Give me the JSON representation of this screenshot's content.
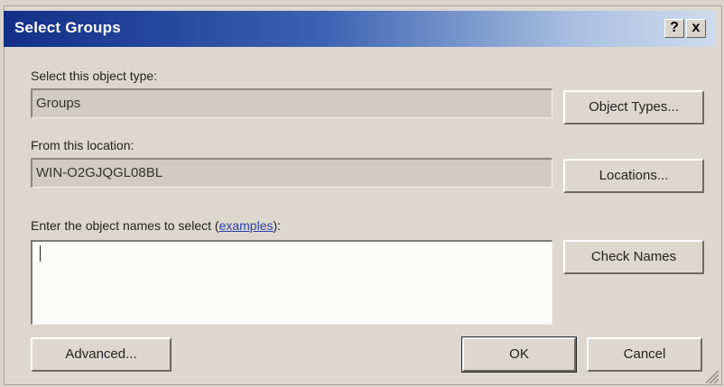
{
  "dialog": {
    "title": "Select Groups",
    "help_glyph": "?",
    "close_glyph": "x"
  },
  "object_type": {
    "label": "Select this object type:",
    "value": "Groups",
    "button": "Object Types..."
  },
  "location": {
    "label": "From this location:",
    "value": "WIN-O2GJQGL08BL",
    "button": "Locations..."
  },
  "names": {
    "label_prefix": "Enter the object names to select (",
    "link": "examples",
    "label_suffix": "):",
    "value": "",
    "check_button": "Check Names"
  },
  "buttons": {
    "advanced": "Advanced...",
    "ok": "OK",
    "cancel": "Cancel"
  },
  "colors": {
    "title_start": "#112f86",
    "title_end": "#cfdbed",
    "face": "#dcd8cf",
    "link": "#2b40a8"
  }
}
